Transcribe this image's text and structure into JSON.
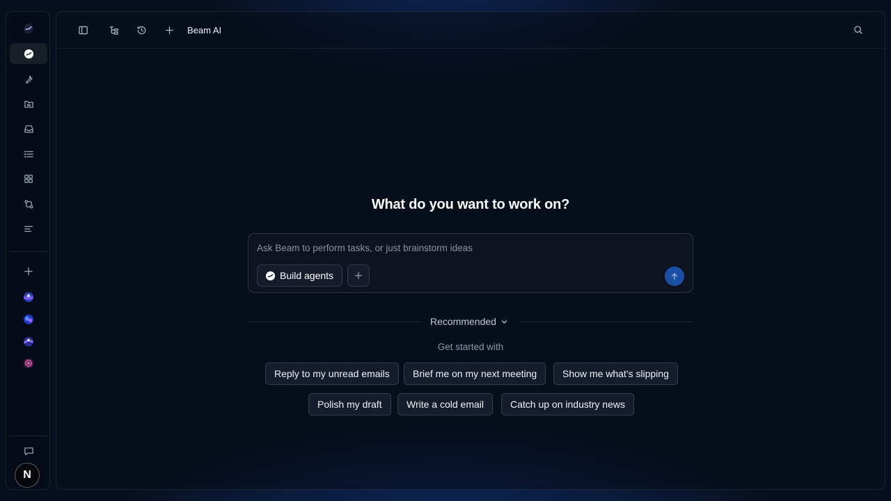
{
  "rail": {
    "items": [
      {
        "name": "home-logo-icon",
        "icon": "beam-logo"
      },
      {
        "name": "chat-icon",
        "icon": "beam-chat",
        "active": true
      },
      {
        "name": "tools-icon",
        "icon": "wrench"
      },
      {
        "name": "folder-icon",
        "icon": "folder"
      },
      {
        "name": "inbox-icon",
        "icon": "inbox"
      },
      {
        "name": "list-icon",
        "icon": "list"
      },
      {
        "name": "grid-icon",
        "icon": "grid"
      },
      {
        "name": "flow-icon",
        "icon": "git-compare"
      },
      {
        "name": "text-lines-icon",
        "icon": "align-left"
      }
    ],
    "avatar_initial": "N"
  },
  "topbar": {
    "title": "Beam AI"
  },
  "main": {
    "headline": "What do you want to work on?",
    "composer": {
      "placeholder": "Ask Beam to perform tasks, or just brainstorm ideas",
      "value": "",
      "build_label": "Build agents"
    },
    "recommended_label": "Recommended",
    "get_started_label": "Get started with",
    "suggestions": [
      "Reply to my unread emails",
      "Brief me on my next meeting",
      "Show me what's slipping",
      "Polish my draft",
      "Write a cold email",
      "Catch up on industry news"
    ]
  },
  "colors": {
    "background": "#07101f",
    "accent": "#1a4fa6",
    "text": "#e6e9ef",
    "muted": "#8f97a6"
  }
}
